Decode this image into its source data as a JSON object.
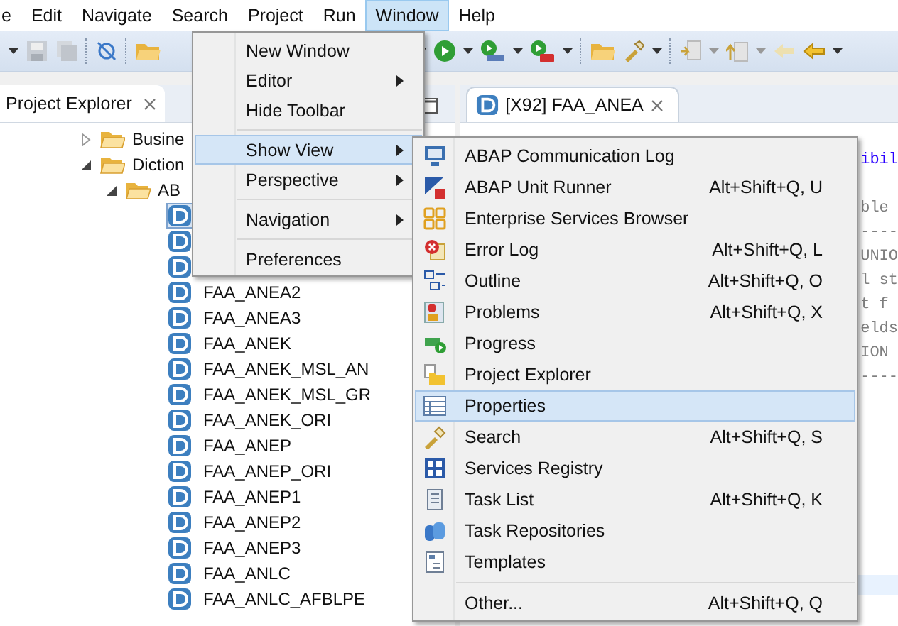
{
  "menu_bar": [
    {
      "label": "e",
      "selected": false
    },
    {
      "label": "Edit",
      "selected": false
    },
    {
      "label": "Navigate",
      "selected": false
    },
    {
      "label": "Search",
      "selected": false
    },
    {
      "label": "Project",
      "selected": false
    },
    {
      "label": "Run",
      "selected": false
    },
    {
      "label": "Window",
      "selected": true
    },
    {
      "label": "Help",
      "selected": false
    }
  ],
  "project_explorer": {
    "title": "Project Explorer",
    "tree": [
      {
        "label": "Busine",
        "expanded": false
      },
      {
        "label": "Diction",
        "expanded": true,
        "children": [
          {
            "label": "AB",
            "expanded": true,
            "children": [
              {
                "selected": true
              },
              {
                "selected": false
              },
              {
                "selected": false
              },
              {
                "label": "FAA_ANEA2",
                "selected": false
              },
              {
                "label": "FAA_ANEA3",
                "selected": false
              },
              {
                "label": "FAA_ANEK",
                "selected": false
              },
              {
                "label": "FAA_ANEK_MSL_AN",
                "selected": false
              },
              {
                "label": "FAA_ANEK_MSL_GR",
                "selected": false
              },
              {
                "label": "FAA_ANEK_ORI",
                "selected": false
              },
              {
                "label": "FAA_ANEP",
                "selected": false
              },
              {
                "label": "FAA_ANEP_ORI",
                "selected": false
              },
              {
                "label": "FAA_ANEP1",
                "selected": false
              },
              {
                "label": "FAA_ANEP2",
                "selected": false
              },
              {
                "label": "FAA_ANEP3",
                "selected": false
              },
              {
                "label": "FAA_ANLC",
                "selected": false
              },
              {
                "label": "FAA_ANLC_AFBLPE",
                "selected": false
              }
            ]
          }
        ]
      }
    ]
  },
  "editor": {
    "tab": {
      "title": "[X92] FAA_ANEA"
    },
    "code_lines": [
      {
        "kind": "string",
        "text": "ibil"
      },
      {
        "kind": "blank"
      },
      {
        "kind": "comment",
        "text": "ble"
      },
      {
        "kind": "comment",
        "text": "----"
      },
      {
        "kind": "comment",
        "text": "UNIO"
      },
      {
        "kind": "comment",
        "text": "l st"
      },
      {
        "kind": "comment",
        "text": "t f"
      },
      {
        "kind": "comment",
        "text": "elds"
      },
      {
        "kind": "comment",
        "text": "ION"
      },
      {
        "kind": "comment",
        "text": "----"
      }
    ]
  },
  "window_menu": {
    "items": [
      {
        "kind": "item",
        "label": "New Window",
        "submenu": false,
        "selected": false
      },
      {
        "kind": "item",
        "label": "Editor",
        "submenu": true,
        "selected": false
      },
      {
        "kind": "item",
        "label": "Hide Toolbar",
        "submenu": false,
        "selected": false
      },
      {
        "kind": "separator"
      },
      {
        "kind": "item",
        "label": "Show View",
        "submenu": true,
        "selected": true
      },
      {
        "kind": "item",
        "label": "Perspective",
        "submenu": true,
        "selected": false
      },
      {
        "kind": "separator"
      },
      {
        "kind": "item",
        "label": "Navigation",
        "submenu": true,
        "selected": false
      },
      {
        "kind": "separator"
      },
      {
        "kind": "item",
        "label": "Preferences",
        "submenu": false,
        "selected": false
      }
    ]
  },
  "show_view_menu": {
    "items": [
      {
        "kind": "item",
        "label": "ABAP Communication Log",
        "selected": false
      },
      {
        "kind": "item",
        "label": "ABAP Unit Runner",
        "shortcut": "Alt+Shift+Q, U",
        "selected": false
      },
      {
        "kind": "item",
        "label": "Enterprise Services Browser",
        "selected": false
      },
      {
        "kind": "item",
        "label": "Error Log",
        "shortcut": "Alt+Shift+Q, L",
        "selected": false
      },
      {
        "kind": "item",
        "label": "Outline",
        "shortcut": "Alt+Shift+Q, O",
        "selected": false
      },
      {
        "kind": "item",
        "label": "Problems",
        "shortcut": "Alt+Shift+Q, X",
        "selected": false
      },
      {
        "kind": "item",
        "label": "Progress",
        "selected": false
      },
      {
        "kind": "item",
        "label": "Project Explorer",
        "selected": false
      },
      {
        "kind": "item",
        "label": "Properties",
        "selected": true
      },
      {
        "kind": "item",
        "label": "Search",
        "shortcut": "Alt+Shift+Q, S",
        "selected": false
      },
      {
        "kind": "item",
        "label": "Services Registry",
        "selected": false
      },
      {
        "kind": "item",
        "label": "Task List",
        "shortcut": "Alt+Shift+Q, K",
        "selected": false
      },
      {
        "kind": "item",
        "label": "Task Repositories",
        "selected": false
      },
      {
        "kind": "item",
        "label": "Templates",
        "selected": false
      },
      {
        "kind": "separator"
      },
      {
        "kind": "item",
        "label": "Other...",
        "shortcut": "Alt+Shift+Q, Q",
        "selected": false
      }
    ]
  }
}
